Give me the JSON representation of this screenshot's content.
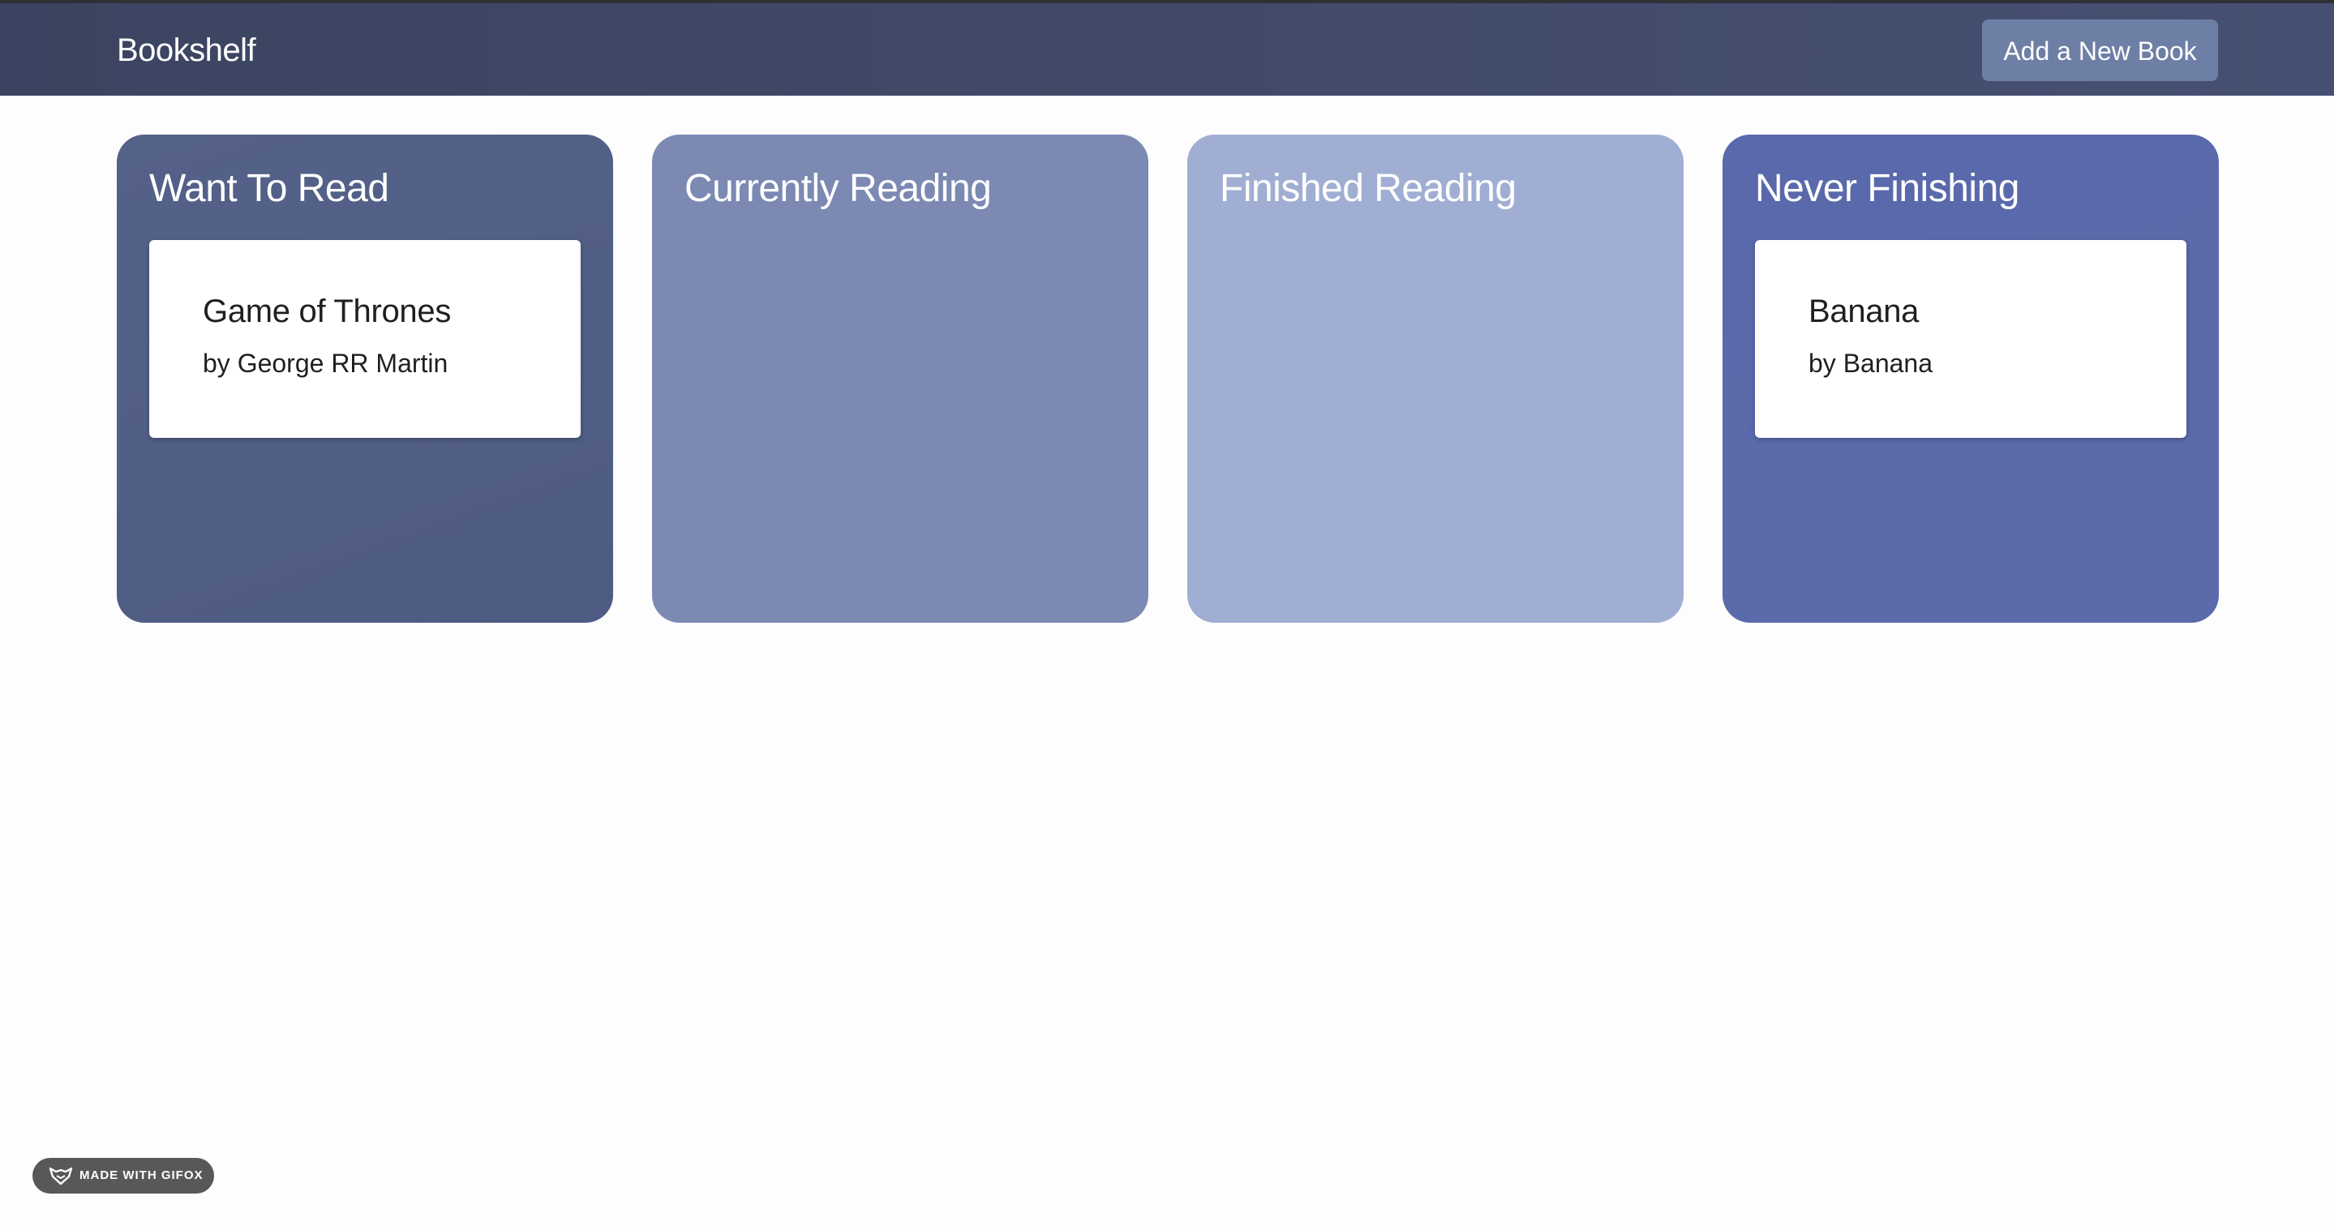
{
  "navbar": {
    "brand": "Bookshelf",
    "add_button_label": "Add a New Book"
  },
  "columns": [
    {
      "title": "Want To Read",
      "books": [
        {
          "title": "Game of Thrones",
          "author": "by George RR Martin"
        }
      ]
    },
    {
      "title": "Currently Reading",
      "books": []
    },
    {
      "title": "Finished Reading",
      "books": []
    },
    {
      "title": "Never Finishing",
      "books": [
        {
          "title": "Banana",
          "author": "by Banana"
        }
      ]
    }
  ],
  "watermark": {
    "label": "MADE WITH GIFOX",
    "icon": "fox-icon"
  },
  "colors": {
    "navbar": "#414a68",
    "button": "#6e7fa6",
    "want_to_read": "#515e86",
    "currently_reading": "#7b89b3",
    "finished_reading": "#a1aed3",
    "never_finishing": "#5a69ab"
  }
}
